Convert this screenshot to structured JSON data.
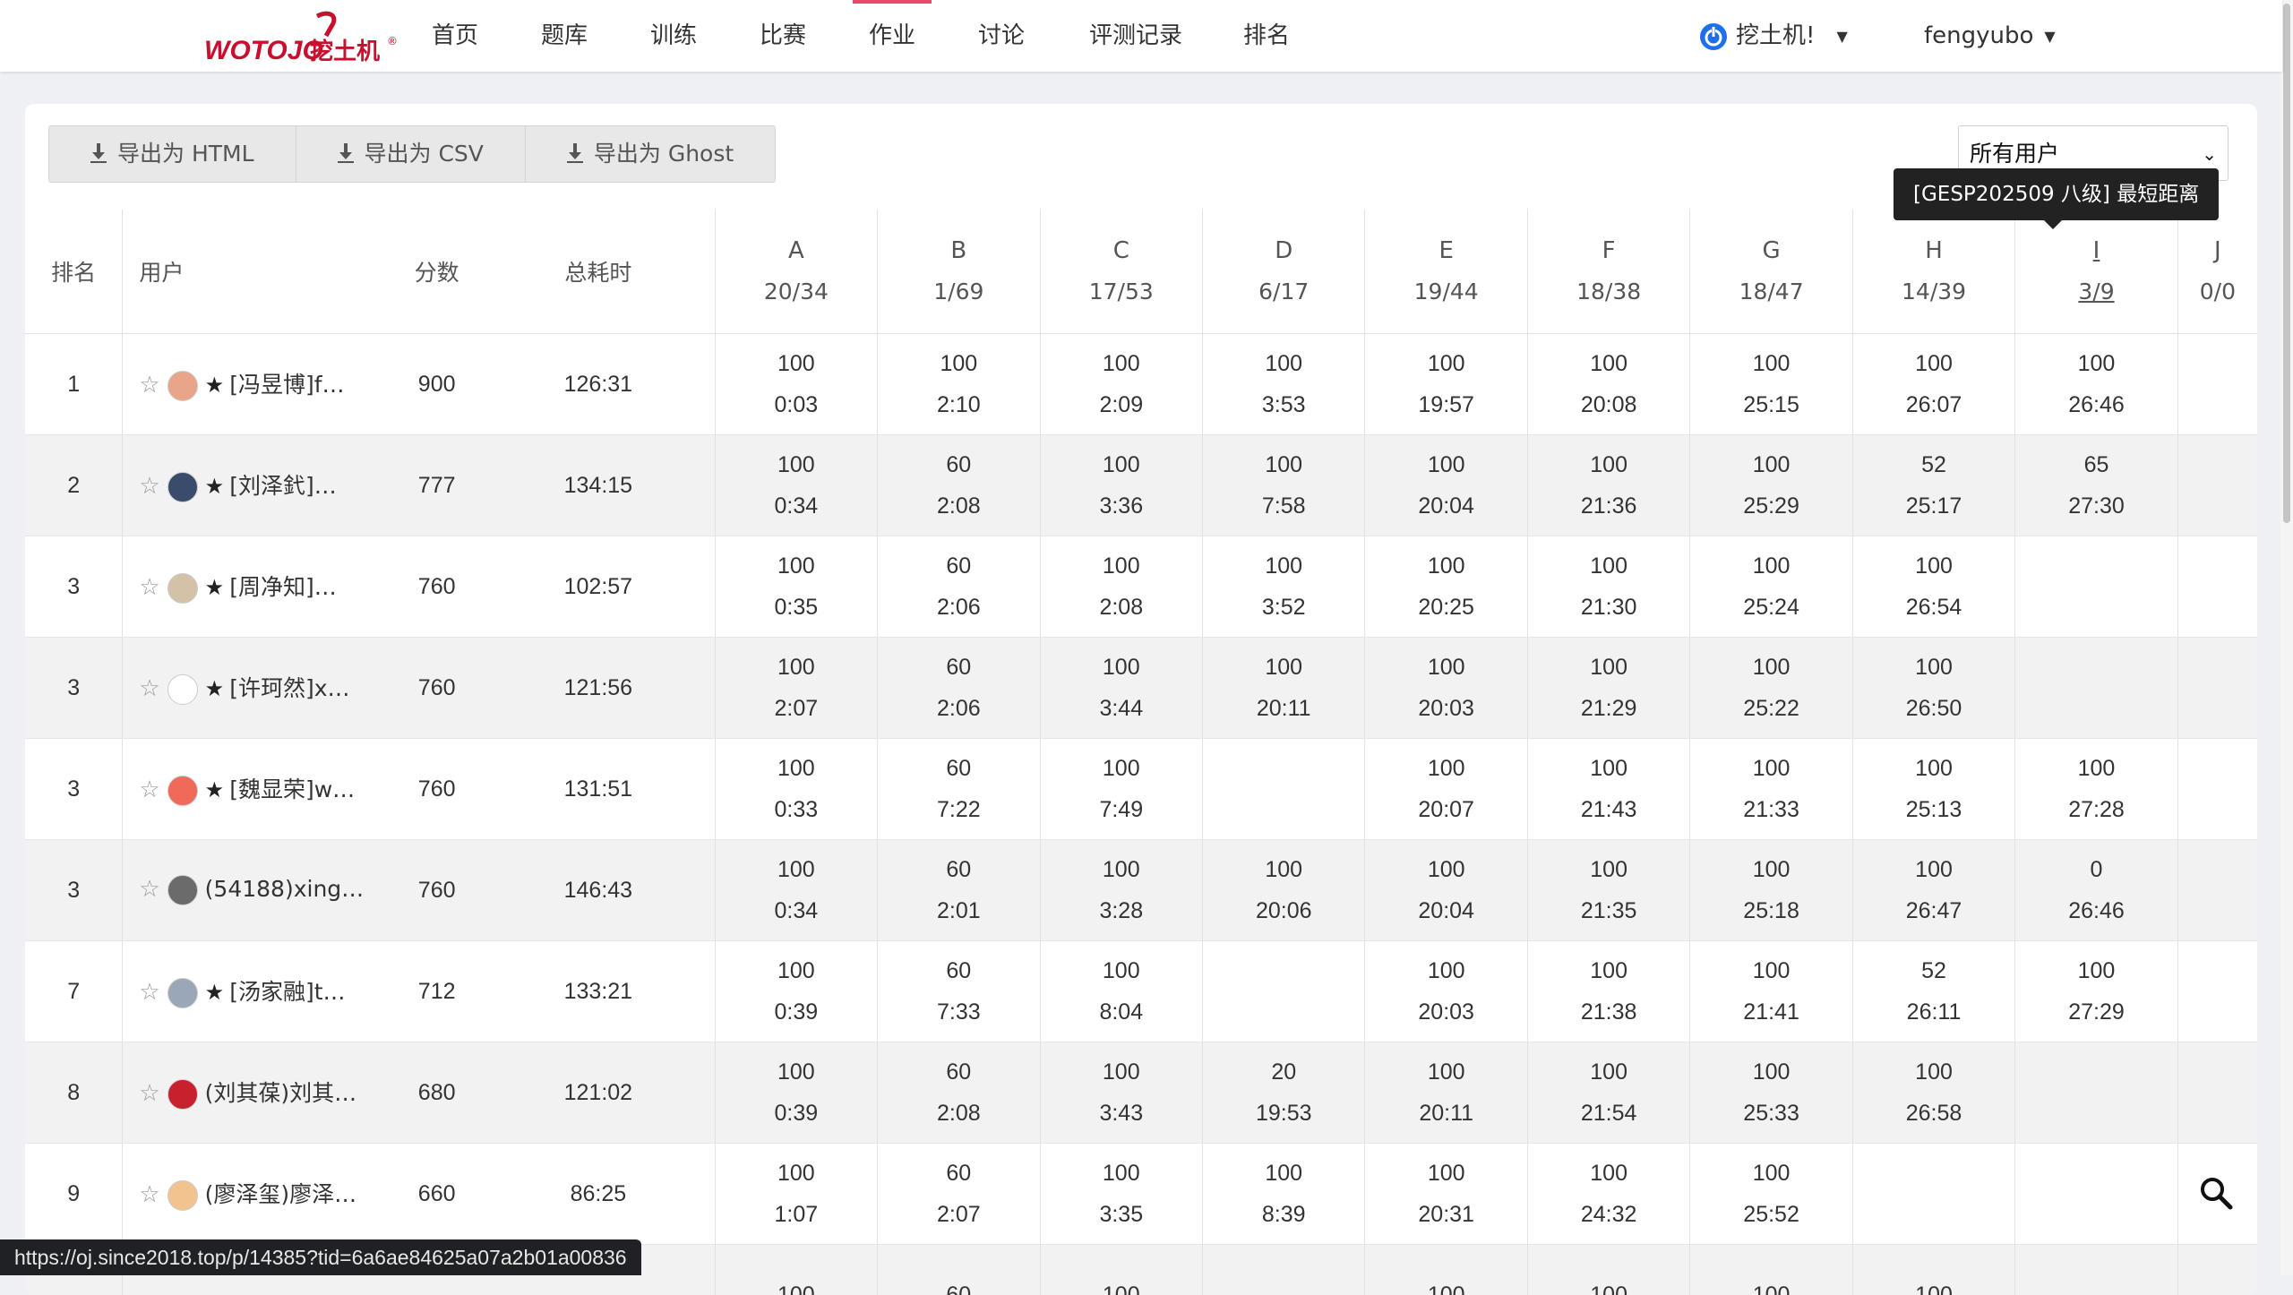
{
  "brand": {
    "logo_text": "WOTOJO",
    "logo_cn": "挖土机",
    "accent": "#c8102e"
  },
  "nav": {
    "items": [
      "首页",
      "题库",
      "训练",
      "比赛",
      "作业",
      "讨论",
      "评测记录",
      "排名"
    ],
    "active_index": 4,
    "domain_label": "挖土机!",
    "username": "fengyubo"
  },
  "toolbar": {
    "export_html": "导出为 HTML",
    "export_csv": "导出为 CSV",
    "export_ghost": "导出为 Ghost",
    "filter_value": "所有用户"
  },
  "tooltip": "[GESP202509 八级] 最短距离",
  "table": {
    "headers": {
      "rank": "排名",
      "user": "用户",
      "score": "分数",
      "time": "总耗时"
    },
    "problems": [
      {
        "label": "A",
        "stat": "20/34"
      },
      {
        "label": "B",
        "stat": "1/69"
      },
      {
        "label": "C",
        "stat": "17/53"
      },
      {
        "label": "D",
        "stat": "6/17"
      },
      {
        "label": "E",
        "stat": "19/44"
      },
      {
        "label": "F",
        "stat": "18/38"
      },
      {
        "label": "G",
        "stat": "18/47"
      },
      {
        "label": "H",
        "stat": "14/39"
      },
      {
        "label": "I",
        "stat": "3/9"
      },
      {
        "label": "J",
        "stat": "0/0"
      }
    ],
    "rows": [
      {
        "rank": "1",
        "user": "[冯昱博]f…",
        "verified": true,
        "score": "900",
        "time": "126:31",
        "cells": [
          [
            "100",
            "0:03",
            "green"
          ],
          [
            "100",
            "2:10",
            "green"
          ],
          [
            "100",
            "2:09",
            "green"
          ],
          [
            "100",
            "3:53",
            "green"
          ],
          [
            "100",
            "19:57",
            "green"
          ],
          [
            "100",
            "20:08",
            "green"
          ],
          [
            "100",
            "25:15",
            "green"
          ],
          [
            "100",
            "26:07",
            "green"
          ],
          [
            "100",
            "26:46",
            "green"
          ],
          null
        ]
      },
      {
        "rank": "2",
        "user": "[刘泽釴]…",
        "verified": true,
        "score": "777",
        "time": "134:15",
        "cells": [
          [
            "100",
            "0:34",
            "green"
          ],
          [
            "60",
            "2:08",
            "yellow"
          ],
          [
            "100",
            "3:36",
            "green"
          ],
          [
            "100",
            "7:58",
            "green"
          ],
          [
            "100",
            "20:04",
            "green"
          ],
          [
            "100",
            "21:36",
            "green"
          ],
          [
            "100",
            "25:29",
            "green"
          ],
          [
            "52",
            "25:17",
            "yellow"
          ],
          [
            "65",
            "27:30",
            "yellow"
          ],
          null
        ]
      },
      {
        "rank": "3",
        "user": "[周净知]…",
        "verified": true,
        "score": "760",
        "time": "102:57",
        "cells": [
          [
            "100",
            "0:35",
            "green"
          ],
          [
            "60",
            "2:06",
            "yellow"
          ],
          [
            "100",
            "2:08",
            "green"
          ],
          [
            "100",
            "3:52",
            "green"
          ],
          [
            "100",
            "20:25",
            "green"
          ],
          [
            "100",
            "21:30",
            "green"
          ],
          [
            "100",
            "25:24",
            "green"
          ],
          [
            "100",
            "26:54",
            "green"
          ],
          null,
          null
        ]
      },
      {
        "rank": "3",
        "user": "[许珂然]x…",
        "verified": true,
        "score": "760",
        "time": "121:56",
        "cells": [
          [
            "100",
            "2:07",
            "green"
          ],
          [
            "60",
            "2:06",
            "yellow"
          ],
          [
            "100",
            "3:44",
            "green"
          ],
          [
            "100",
            "20:11",
            "green"
          ],
          [
            "100",
            "20:03",
            "green"
          ],
          [
            "100",
            "21:29",
            "green"
          ],
          [
            "100",
            "25:22",
            "green"
          ],
          [
            "100",
            "26:50",
            "green"
          ],
          null,
          null
        ]
      },
      {
        "rank": "3",
        "user": "[魏显荣]w…",
        "verified": true,
        "score": "760",
        "time": "131:51",
        "cells": [
          [
            "100",
            "0:33",
            "green"
          ],
          [
            "60",
            "7:22",
            "yellow"
          ],
          [
            "100",
            "7:49",
            "green"
          ],
          null,
          [
            "100",
            "20:07",
            "green"
          ],
          [
            "100",
            "21:43",
            "green"
          ],
          [
            "100",
            "21:33",
            "green"
          ],
          [
            "100",
            "25:13",
            "green"
          ],
          [
            "100",
            "27:28",
            "green"
          ],
          null
        ]
      },
      {
        "rank": "3",
        "user": "(54188)xing…",
        "verified": false,
        "score": "760",
        "time": "146:43",
        "cells": [
          [
            "100",
            "0:34",
            "green"
          ],
          [
            "60",
            "2:01",
            "yellow"
          ],
          [
            "100",
            "3:28",
            "green"
          ],
          [
            "100",
            "20:06",
            "green"
          ],
          [
            "100",
            "20:04",
            "green"
          ],
          [
            "100",
            "21:35",
            "green"
          ],
          [
            "100",
            "25:18",
            "green"
          ],
          [
            "100",
            "26:47",
            "green"
          ],
          [
            "0",
            "26:46",
            "red"
          ],
          null
        ]
      },
      {
        "rank": "7",
        "user": "[汤家融]t…",
        "verified": true,
        "score": "712",
        "time": "133:21",
        "cells": [
          [
            "100",
            "0:39",
            "green"
          ],
          [
            "60",
            "7:33",
            "yellow"
          ],
          [
            "100",
            "8:04",
            "green"
          ],
          null,
          [
            "100",
            "20:03",
            "green"
          ],
          [
            "100",
            "21:38",
            "green"
          ],
          [
            "100",
            "21:41",
            "green"
          ],
          [
            "52",
            "26:11",
            "yellow"
          ],
          [
            "100",
            "27:29",
            "green"
          ],
          null
        ]
      },
      {
        "rank": "8",
        "user": "(刘其葆)刘其…",
        "verified": false,
        "score": "680",
        "time": "121:02",
        "cells": [
          [
            "100",
            "0:39",
            "green"
          ],
          [
            "60",
            "2:08",
            "yellow"
          ],
          [
            "100",
            "3:43",
            "green"
          ],
          [
            "20",
            "19:53",
            "red"
          ],
          [
            "100",
            "20:11",
            "green"
          ],
          [
            "100",
            "21:54",
            "green"
          ],
          [
            "100",
            "25:33",
            "green"
          ],
          [
            "100",
            "26:58",
            "green"
          ],
          null,
          null
        ]
      },
      {
        "rank": "9",
        "user": "(廖泽玺)廖泽…",
        "verified": false,
        "score": "660",
        "time": "86:25",
        "cells": [
          [
            "100",
            "1:07",
            "green"
          ],
          [
            "60",
            "2:07",
            "yellow"
          ],
          [
            "100",
            "3:35",
            "green"
          ],
          [
            "100",
            "8:39",
            "green"
          ],
          [
            "100",
            "20:31",
            "green"
          ],
          [
            "100",
            "24:32",
            "green"
          ],
          [
            "100",
            "25:52",
            "green"
          ],
          null,
          null,
          null
        ]
      },
      {
        "rank": "",
        "user": "",
        "verified": false,
        "score": "",
        "time": "",
        "cells": [
          [
            "100",
            "",
            "green"
          ],
          [
            "60",
            "",
            "yellow"
          ],
          [
            "100",
            "",
            "green"
          ],
          null,
          [
            "100",
            "",
            "green"
          ],
          [
            "100",
            "",
            "green"
          ],
          [
            "100",
            "",
            "green"
          ],
          [
            "100",
            "",
            "green"
          ],
          null,
          null
        ]
      }
    ]
  },
  "status_url": "https://oj.since2018.top/p/14385?tid=6a6ae84625a07a2b01a00836",
  "colors": {
    "green": "#2ba245",
    "yellow": "#e6b320",
    "red": "#e8413c",
    "nav_active": "#e84a6d"
  }
}
